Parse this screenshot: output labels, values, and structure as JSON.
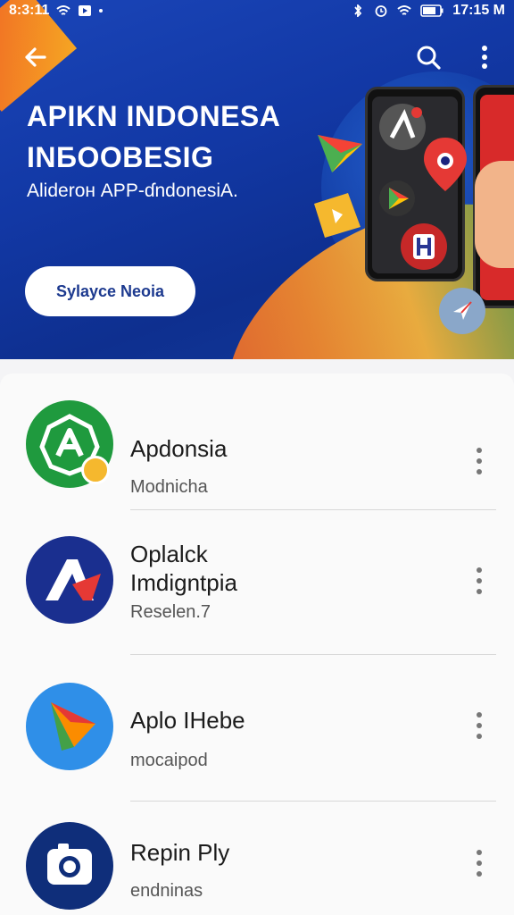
{
  "status_bar": {
    "time": "8:3:11",
    "clock_right": "17:15 M"
  },
  "hero": {
    "title_line1": "APIKN INDONESA",
    "title_line2": "INБOOBESIG",
    "subtitle": "Aliderон APP-ɗndonesiA.",
    "button_label": "Sylayce Neoia"
  },
  "apps": [
    {
      "title": "Apdonsia",
      "subtitle": "Modnicha",
      "icon": "green-a-icon",
      "color": "#1f9a3e"
    },
    {
      "title": "Oplalck\nImdigntpia",
      "subtitle": "Reselen.7",
      "icon": "red-a-icon",
      "color": "#1a2f8f"
    },
    {
      "title": "Aplo IHebe",
      "subtitle": "mocaipod",
      "icon": "play-triangle-icon",
      "color": "#2f8fe8"
    },
    {
      "title": "Repin Ply",
      "subtitle": "endninas",
      "icon": "camera-icon",
      "color": "#0f2e7a"
    }
  ]
}
